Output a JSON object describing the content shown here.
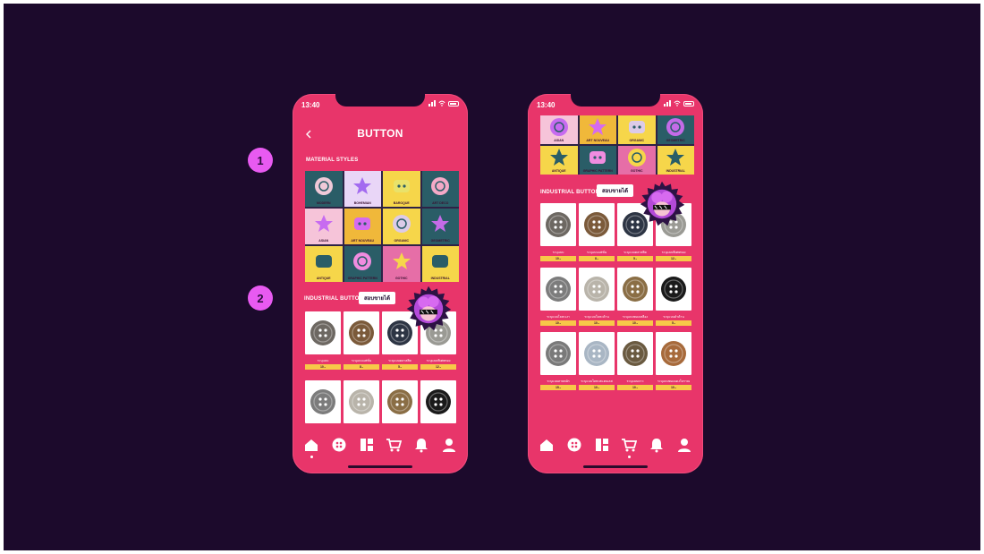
{
  "markers": [
    "1",
    "2"
  ],
  "colors": {
    "backdrop": "#1c0a2c",
    "phone": "#e8356a",
    "price_tag": "#f7c948",
    "marker": "#e85af1"
  },
  "phone_left": {
    "status": {
      "time": "13:40"
    },
    "header": {
      "title": "BUTTON",
      "back_icon": "chevron-left-icon"
    },
    "material_styles": {
      "heading": "MATERIAL STYLES",
      "tiles": [
        {
          "label": "MODERN",
          "bg": "#2a5d67",
          "accent": "#f0c9d8"
        },
        {
          "label": "BOHEMIAN",
          "bg": "#e9d6f7",
          "accent": "#a36bf0"
        },
        {
          "label": "BAROQUE",
          "bg": "#f6d64a",
          "accent": "#e9e26a"
        },
        {
          "label": "ART DECO",
          "bg": "#2a5d67",
          "accent": "#f5a9c7"
        },
        {
          "label": "ASIAN",
          "bg": "#f6c4d9",
          "accent": "#c76bf0"
        },
        {
          "label": "ART NOUVEAU",
          "bg": "#f0b83a",
          "accent": "#d56bf0"
        },
        {
          "label": "ORGANIC",
          "bg": "#f6d64a",
          "accent": "#dccbe8"
        },
        {
          "label": "GEOMETRIC",
          "bg": "#2a5d67",
          "accent": "#c46be8"
        },
        {
          "label": "ANTIQUE",
          "bg": "#f6d64a",
          "accent": "#2a5d67"
        },
        {
          "label": "GRAPHIC PATTERN",
          "bg": "#2a5d67",
          "accent": "#f08ce0"
        },
        {
          "label": "GOTHIC",
          "bg": "#e66ea7",
          "accent": "#f6d64a"
        },
        {
          "label": "INDUSTRIAL",
          "bg": "#f6d64a",
          "accent": "#2a5d67"
        }
      ]
    },
    "industrial": {
      "heading": "INDUSTRIAL BUTTON",
      "badge": "สอบขายได้",
      "items": [
        {
          "name": "ระบุแบบ",
          "price": "10.-",
          "color": "#6d6862"
        },
        {
          "name": "ระบุแบบแฟชั่น",
          "price": "8.-",
          "color": "#7b5a3a"
        },
        {
          "name": "ระบุแบบคลาสสิค",
          "price": "5.-",
          "color": "#2d3544"
        },
        {
          "name": "ระบุแบบพิเศษทอง",
          "price": "12.-",
          "color": "#9a9a94"
        },
        {
          "name": "",
          "price": "",
          "color": "#7c7c7c"
        },
        {
          "name": "",
          "price": "",
          "color": "#b9b4aa"
        },
        {
          "name": "",
          "price": "",
          "color": "#8a6e45"
        },
        {
          "name": "",
          "price": "",
          "color": "#1a1a1a"
        }
      ]
    },
    "nav": [
      "home-icon",
      "button-icon",
      "catalog-icon",
      "cart-icon",
      "bell-icon",
      "profile-icon"
    ]
  },
  "phone_right": {
    "status": {
      "time": "13:40"
    },
    "material_styles": {
      "tiles": [
        {
          "label": "ASIAN",
          "bg": "#f6c4d9",
          "accent": "#c76bf0"
        },
        {
          "label": "ART NOUVEAU",
          "bg": "#f0b83a",
          "accent": "#d56bf0"
        },
        {
          "label": "ORGANIC",
          "bg": "#f6d64a",
          "accent": "#dccbe8"
        },
        {
          "label": "GEOMETRIC",
          "bg": "#2a5d67",
          "accent": "#c46be8"
        },
        {
          "label": "ANTIQUE",
          "bg": "#f6d64a",
          "accent": "#2a5d67"
        },
        {
          "label": "GRAPHIC PATTERN",
          "bg": "#2a5d67",
          "accent": "#f08ce0"
        },
        {
          "label": "GOTHIC",
          "bg": "#e66ea7",
          "accent": "#f6d64a"
        },
        {
          "label": "INDUSTRIAL",
          "bg": "#f6d64a",
          "accent": "#2a5d67"
        }
      ]
    },
    "industrial": {
      "heading": "INDUSTRIAL BUTTON",
      "badge": "สอบขายได้",
      "items": [
        {
          "name": "ระบุแบบ",
          "price": "10.-",
          "color": "#6d6862"
        },
        {
          "name": "ระบุแบบแฟชั่น",
          "price": "8.-",
          "color": "#7b5a3a"
        },
        {
          "name": "ระบุแบบคลาสสิค",
          "price": "5.-",
          "color": "#2d3544"
        },
        {
          "name": "ระบุแบบพิเศษทอง",
          "price": "12.-",
          "color": "#9a9a94"
        },
        {
          "name": "ระบุแบบโลหะเงา",
          "price": "10.-",
          "color": "#7c7c7c"
        },
        {
          "name": "ระบุแบบโลหะด้าน",
          "price": "10.-",
          "color": "#b9b4aa"
        },
        {
          "name": "ระบุแบบทองเหลือง",
          "price": "10.-",
          "color": "#8a6e45"
        },
        {
          "name": "ระบุแบบดำด้าน",
          "price": "5.-",
          "color": "#1a1a1a"
        },
        {
          "name": "ระบุแบบลายหยัก",
          "price": "15.-",
          "color": "#7a7a7a"
        },
        {
          "name": "ระบุแบบโลหะสแตนเลส",
          "price": "10.-",
          "color": "#a9b6c4"
        },
        {
          "name": "ระบุแบบดาว",
          "price": "10.-",
          "color": "#6a5a40"
        },
        {
          "name": "ระบุแบบทองแดงโบราณ",
          "price": "10.-",
          "color": "#a76a3b"
        }
      ]
    },
    "nav": [
      "home-icon",
      "button-icon",
      "catalog-icon",
      "cart-icon",
      "bell-icon",
      "profile-icon"
    ]
  }
}
